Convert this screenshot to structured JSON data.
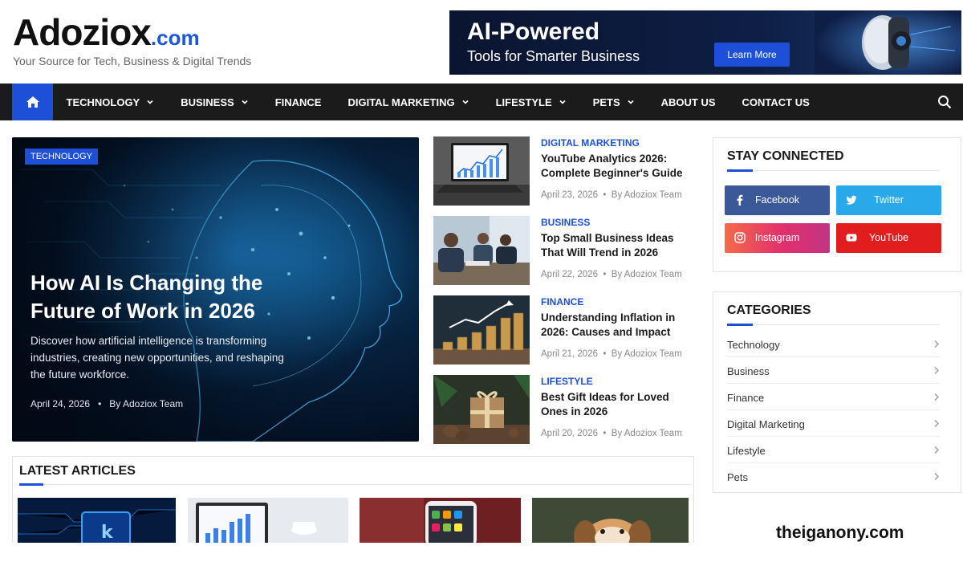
{
  "site": {
    "logo_main": "Adoziox",
    "logo_tld": ".com",
    "tagline": "Your Source for Tech, Business & Digital Trends"
  },
  "ad": {
    "title": "AI-Powered",
    "subtitle": "Tools for Smarter Business",
    "button": "Learn More"
  },
  "nav": {
    "items": [
      {
        "label": "TECHNOLOGY",
        "dropdown": true
      },
      {
        "label": "BUSINESS",
        "dropdown": true
      },
      {
        "label": "FINANCE",
        "dropdown": false
      },
      {
        "label": "DIGITAL MARKETING",
        "dropdown": true
      },
      {
        "label": "LIFESTYLE",
        "dropdown": true
      },
      {
        "label": "PETS",
        "dropdown": true
      },
      {
        "label": "ABOUT US",
        "dropdown": false
      },
      {
        "label": "CONTACT US",
        "dropdown": false
      }
    ],
    "home_icon": "home-icon",
    "search_icon": "search-icon"
  },
  "hero": {
    "category": "TECHNOLOGY",
    "title": "How AI Is Changing the Future of Work in 2026",
    "description": "Discover how artificial intelligence is transforming industries, creating new opportunities, and reshaping the future workforce.",
    "date": "April 24, 2026",
    "author": "By Adoziox Team"
  },
  "articles": [
    {
      "category": "DIGITAL MARKETING",
      "title": "YouTube Analytics 2026: Complete Beginner's Guide",
      "date": "April 23, 2026",
      "author": "By Adoziox Team"
    },
    {
      "category": "BUSINESS",
      "title": "Top Small Business Ideas That Will Trend in 2026",
      "date": "April 22, 2026",
      "author": "By Adoziox Team"
    },
    {
      "category": "FINANCE",
      "title": "Understanding Inflation in 2026: Causes and Impact",
      "date": "April 21, 2026",
      "author": "By Adoziox Team"
    },
    {
      "category": "LIFESTYLE",
      "title": "Best Gift Ideas for Loved Ones in 2026",
      "date": "April 20, 2026",
      "author": "By Adoziox Team"
    }
  ],
  "stay_connected": {
    "title": "STAY CONNECTED",
    "buttons": [
      {
        "label": "Facebook",
        "color": "#3b5998",
        "icon": "facebook-icon"
      },
      {
        "label": "Twitter",
        "color": "#29a9e9",
        "icon": "twitter-icon"
      },
      {
        "label": "Instagram",
        "color": "#e1306c",
        "icon": "instagram-icon"
      },
      {
        "label": "YouTube",
        "color": "#e11d1d",
        "icon": "youtube-icon"
      }
    ]
  },
  "categories": {
    "title": "CATEGORIES",
    "items": [
      "Technology",
      "Business",
      "Finance",
      "Digital Marketing",
      "Lifestyle",
      "Pets"
    ]
  },
  "latest": {
    "title": "LATEST ARTICLES"
  },
  "watermark": "theiganony.com",
  "colors": {
    "accent": "#1d4fd8",
    "nav_bg": "#1b1b1b"
  }
}
